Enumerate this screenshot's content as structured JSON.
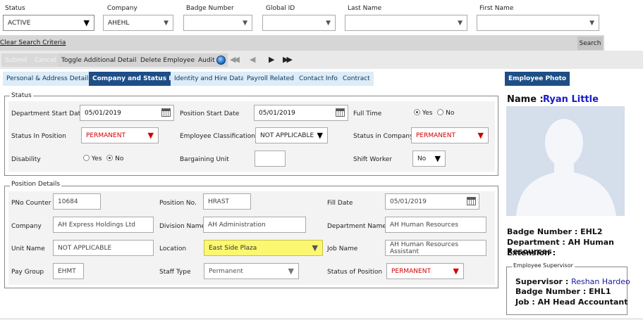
{
  "search": {
    "status_label": "Status",
    "status_value": "ACTIVE",
    "company_label": "Company",
    "company_value": "AHEHL",
    "badge_label": "Badge Number",
    "badge_value": "",
    "global_label": "Global ID",
    "global_value": "",
    "last_label": "Last Name",
    "last_value": "",
    "first_label": "First Name",
    "first_value": "",
    "clear_link": "Clear Search Criteria",
    "search_button": "Search"
  },
  "toolbar": {
    "submit": "Submit",
    "cancel": "Cancel",
    "toggle": "Toggle Additional Details",
    "delete": "Delete Employee",
    "audit": "Audit"
  },
  "tabs": [
    "Personal & Address Details",
    "Company and Status Info",
    "Identity and Hire Data",
    "Payroll Related",
    "Contact Info",
    "Contract"
  ],
  "employee_photo_tab": "Employee Photo",
  "status_section": {
    "legend": "Status",
    "dept_start_label": "Department Start Date",
    "dept_start_value": "05/01/2019",
    "pos_start_label": "Position Start Date",
    "pos_start_value": "05/01/2019",
    "full_time_label": "Full Time",
    "yes": "Yes",
    "no": "No",
    "status_in_position_label": "Status In Position",
    "status_in_position_value": "PERMANENT",
    "emp_class_label": "Employee Classifications",
    "emp_class_value": "NOT APPLICABLE",
    "status_in_company_label": "Status in Company",
    "status_in_company_value": "PERMANENT",
    "disability_label": "Disability",
    "bargaining_label": "Bargaining Unit",
    "bargaining_value": "",
    "shift_label": "Shift Worker",
    "shift_value": "No"
  },
  "position_section": {
    "legend": "Position Details",
    "pno_label": "PNo Counter",
    "pno_value": "10684",
    "posno_label": "Position No.",
    "posno_value": "HRAST",
    "fill_label": "Fill Date",
    "fill_value": "05/01/2019",
    "company_label": "Company",
    "company_value": "AH Express Holdings Ltd",
    "division_label": "Division Name",
    "division_value": "AH Administration",
    "dept_label": "Department Name",
    "dept_value": "AH Human Resources",
    "unit_label": "Unit Name",
    "unit_value": "NOT APPLICABLE",
    "location_label": "Location",
    "location_value": "East Side Plaza",
    "job_label": "Job Name",
    "job_value": "AH Human Resources Assistant",
    "paygroup_label": "Pay Group",
    "paygroup_value": "EHMT",
    "staff_label": "Staff Type",
    "staff_value": "Permanent",
    "status_pos_label": "Status of Position",
    "status_pos_value": "PERMANENT"
  },
  "employee": {
    "name_label": "Name :",
    "name": "Ryan Little",
    "badge": "Badge Number : EHL2",
    "department": "Department : AH Human Resources",
    "extension": "Extension :"
  },
  "supervisor": {
    "legend": "Employee Supervisor",
    "supervisor_label": "Supervisor :",
    "supervisor_name": "Reshan Hardeo",
    "badge": "Badge Number : EHL1",
    "job": "Job : AH Head Accountant"
  },
  "colors": {
    "tab_active": "#1d4e86",
    "tab_inactive": "#dcecf8",
    "name_blue": "#1a1acc",
    "error_red": "#d00000",
    "location_highlight": "#fbf770"
  }
}
